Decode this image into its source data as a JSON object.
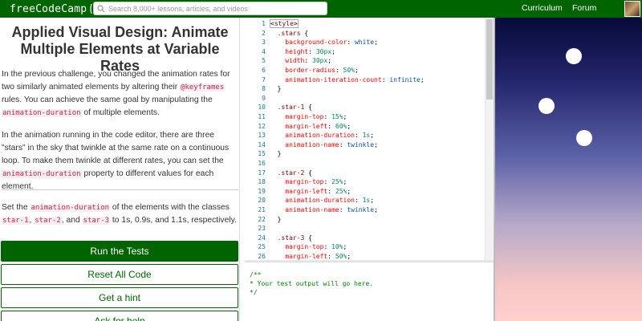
{
  "nav": {
    "logo_text": "freeCodeCamp",
    "logo_icon": "flame-icon",
    "search_placeholder": "Search 8,000+ lessons, articles, and videos",
    "search_icon": "search-icon",
    "links": [
      "Curriculum",
      "Forum"
    ],
    "avatar_icon": "user-avatar",
    "brand_color": "#006400"
  },
  "challenge": {
    "title": "Applied Visual Design: Animate Multiple Elements at Variable Rates",
    "p1": {
      "t1": "In the previous challenge, you changed the animation rates for two similarly animated elements by altering their ",
      "c1": "@keyframes",
      "t2": " rules. You can achieve the same goal by manipulating the ",
      "c2": "animation-duration",
      "t3": " of multiple elements."
    },
    "p2": {
      "t1": "In the animation running in the code editor, there are three \"stars\" in the sky that twinkle at the same rate on a continuous loop. To make them twinkle at different rates, you can set the ",
      "c1": "animation-duration",
      "t2": " property to different values for each element."
    },
    "p3": {
      "t1": "Set the ",
      "c1": "animation-duration",
      "t2": " of the elements with the classes ",
      "c2": "star-1",
      "t3": ", ",
      "c3": "star-2",
      "t4": ", and ",
      "c4": "star-3",
      "t5": " to 1s, 0.9s, and 1.1s, respectively."
    }
  },
  "buttons": {
    "run": "Run the Tests",
    "reset": "Reset All Code",
    "hint": "Get a hint",
    "help": "Ask for help"
  },
  "editor": {
    "lines": [
      "<style>",
      "  .stars {",
      "    background-color: white;",
      "    height: 30px;",
      "    width: 30px;",
      "    border-radius: 50%;",
      "    animation-iteration-count: infinite;",
      "  }",
      "",
      "  .star-1 {",
      "    margin-top: 15%;",
      "    margin-left: 60%;",
      "    animation-duration: 1s;",
      "    animation-name: twinkle;",
      "  }",
      "",
      "  .star-2 {",
      "    margin-top: 25%;",
      "    margin-left: 25%;",
      "    animation-duration: 1s;",
      "    animation-name: twinkle;",
      "  }",
      "",
      "  .star-3 {",
      "    margin-top: 10%;",
      "    margin-left: 50%;"
    ]
  },
  "output": {
    "lines": [
      "/**",
      "* Your test output will go here.",
      "*/"
    ]
  }
}
